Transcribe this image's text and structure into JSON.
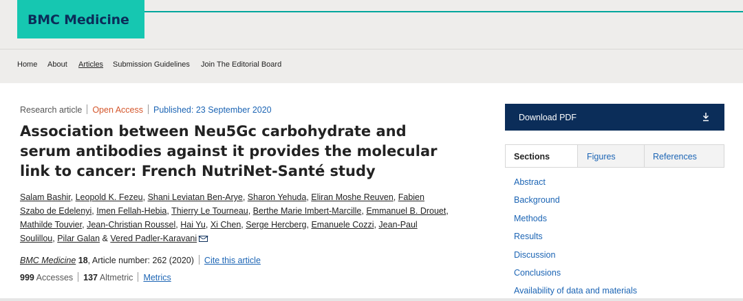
{
  "header": {
    "logo_text": "BMC Medicine"
  },
  "nav": [
    "Home",
    "About",
    "Articles",
    "Submission Guidelines",
    "Join The Editorial Board"
  ],
  "article": {
    "type": "Research article",
    "access": "Open Access",
    "published": "Published: 23 September 2020",
    "title": "Association between Neu5Gc carbohydrate and serum antibodies against it provides the molecular link to cancer: French NutriNet-Santé study",
    "authors": [
      "Salam Bashir",
      "Leopold K. Fezeu",
      "Shani Leviatan Ben-Arye",
      "Sharon Yehuda",
      "Eliran Moshe Reuven",
      "Fabien Szabo de Edelenyi",
      "Imen Fellah-Hebia",
      "Thierry Le Tourneau",
      "Berthe Marie Imbert-Marcille",
      "Emmanuel B. Drouet",
      "Mathilde Touvier",
      "Jean-Christian Roussel",
      "Hai Yu",
      "Xi Chen",
      "Serge Hercberg",
      "Emanuele Cozzi",
      "Jean-Paul Soulillou",
      "Pilar Galan",
      "Vered Padler-Karavani"
    ],
    "journal": "BMC Medicine",
    "volume": "18",
    "article_number": ", Article number: 262 (2020)",
    "cite": "Cite this article",
    "accesses_count": "999",
    "accesses_label": "Accesses",
    "altmetric_count": "137",
    "altmetric_label": "Altmetric",
    "metrics_link": "Metrics"
  },
  "sidebar": {
    "download_label": "Download PDF",
    "tabs": [
      "Sections",
      "Figures",
      "References"
    ],
    "sections": [
      "Abstract",
      "Background",
      "Methods",
      "Results",
      "Discussion",
      "Conclusions",
      "Availability of data and materials"
    ]
  },
  "colors": {
    "brand_teal": "#16c7b1",
    "navy": "#0b2d59",
    "link_blue": "#1b64b4",
    "open_access": "#d4562b"
  }
}
